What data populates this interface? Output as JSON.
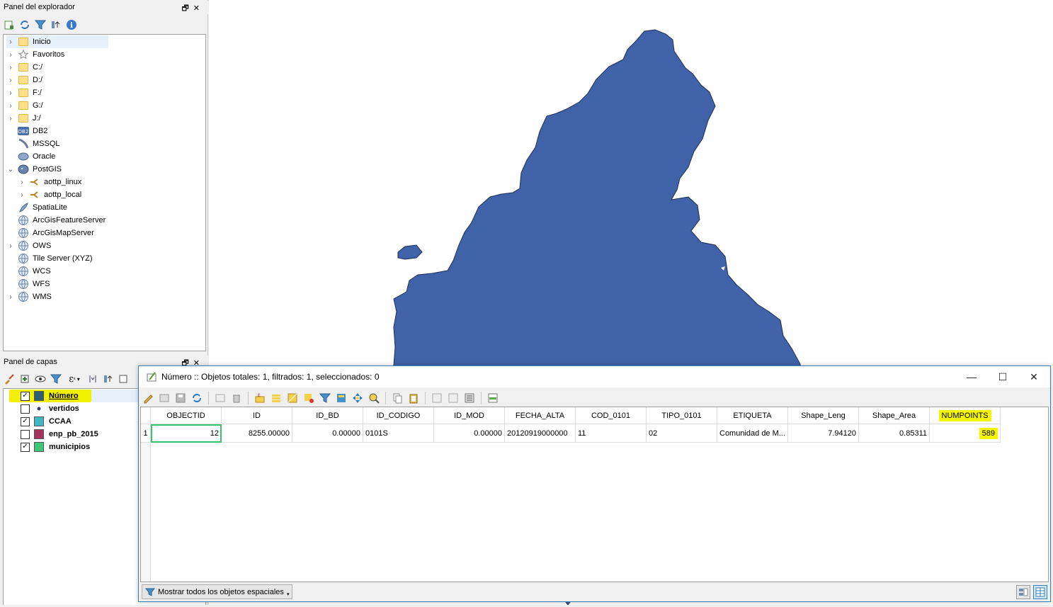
{
  "explorer": {
    "title": "Panel del explorador",
    "items": [
      {
        "label": "Inicio",
        "icon": "folder-icon",
        "arrow": "›",
        "indent": 0
      },
      {
        "label": "Favoritos",
        "icon": "star-icon",
        "arrow": "›",
        "indent": 0
      },
      {
        "label": "C:/",
        "icon": "folder-icon",
        "arrow": "›",
        "indent": 0
      },
      {
        "label": "D:/",
        "icon": "folder-icon",
        "arrow": "›",
        "indent": 0
      },
      {
        "label": "F:/",
        "icon": "folder-icon",
        "arrow": "›",
        "indent": 0
      },
      {
        "label": "G:/",
        "icon": "folder-icon",
        "arrow": "›",
        "indent": 0
      },
      {
        "label": "J:/",
        "icon": "folder-icon",
        "arrow": "›",
        "indent": 0
      },
      {
        "label": "DB2",
        "icon": "db2-icon",
        "arrow": "",
        "indent": 0
      },
      {
        "label": "MSSQL",
        "icon": "mssql-icon",
        "arrow": "",
        "indent": 0
      },
      {
        "label": "Oracle",
        "icon": "oracle-icon",
        "arrow": "",
        "indent": 0
      },
      {
        "label": "PostGIS",
        "icon": "postgis-icon",
        "arrow": "⌄",
        "indent": 0
      },
      {
        "label": "aottp_linux",
        "icon": "connection-icon",
        "arrow": "›",
        "indent": 1
      },
      {
        "label": "aottp_local",
        "icon": "connection-icon",
        "arrow": "›",
        "indent": 1
      },
      {
        "label": "SpatiaLite",
        "icon": "spatialite-icon",
        "arrow": "",
        "indent": 0
      },
      {
        "label": "ArcGisFeatureServer",
        "icon": "globe-icon",
        "arrow": "",
        "indent": 0
      },
      {
        "label": "ArcGisMapServer",
        "icon": "globe-icon",
        "arrow": "",
        "indent": 0
      },
      {
        "label": "OWS",
        "icon": "globe-icon",
        "arrow": "›",
        "indent": 0
      },
      {
        "label": "Tile Server (XYZ)",
        "icon": "globe-icon",
        "arrow": "",
        "indent": 0
      },
      {
        "label": "WCS",
        "icon": "globe-icon",
        "arrow": "",
        "indent": 0
      },
      {
        "label": "WFS",
        "icon": "globe-icon",
        "arrow": "",
        "indent": 0
      },
      {
        "label": "WMS",
        "icon": "globe-icon",
        "arrow": "›",
        "indent": 0
      }
    ]
  },
  "layers": {
    "title": "Panel de capas",
    "items": [
      {
        "label": "Número",
        "checked": true,
        "swatch": "#2e5f72",
        "highlight": true
      },
      {
        "label": "vertidos",
        "checked": false,
        "swatch": "dot",
        "highlight": false
      },
      {
        "label": "CCAA",
        "checked": true,
        "swatch": "#3fb8c2",
        "highlight": false
      },
      {
        "label": "enp_pb_2015",
        "checked": false,
        "swatch": "#a3355f",
        "highlight": false
      },
      {
        "label": "municipios",
        "checked": true,
        "swatch": "#3ec774",
        "highlight": false
      }
    ]
  },
  "map": {
    "fill": "#4062a8",
    "stroke": "#1f2f55"
  },
  "attr": {
    "title": "Número :: Objetos totales: 1, filtrados: 1, seleccionados: 0",
    "columns": [
      "OBJECTID",
      "ID",
      "ID_BD",
      "ID_CODIGO",
      "ID_MOD",
      "FECHA_ALTA",
      "COD_0101",
      "TIPO_0101",
      "ETIQUETA",
      "Shape_Leng",
      "Shape_Area",
      "NUMPOINTS"
    ],
    "row_number": "1",
    "row": [
      "12",
      "8255.00000",
      "0.00000",
      "0101S",
      "0.00000",
      "20120919000000",
      "11",
      "02",
      "Comunidad de M...",
      "7.94120",
      "0.85311",
      "589"
    ],
    "show_all": "Mostrar todos los objetos espaciales"
  }
}
